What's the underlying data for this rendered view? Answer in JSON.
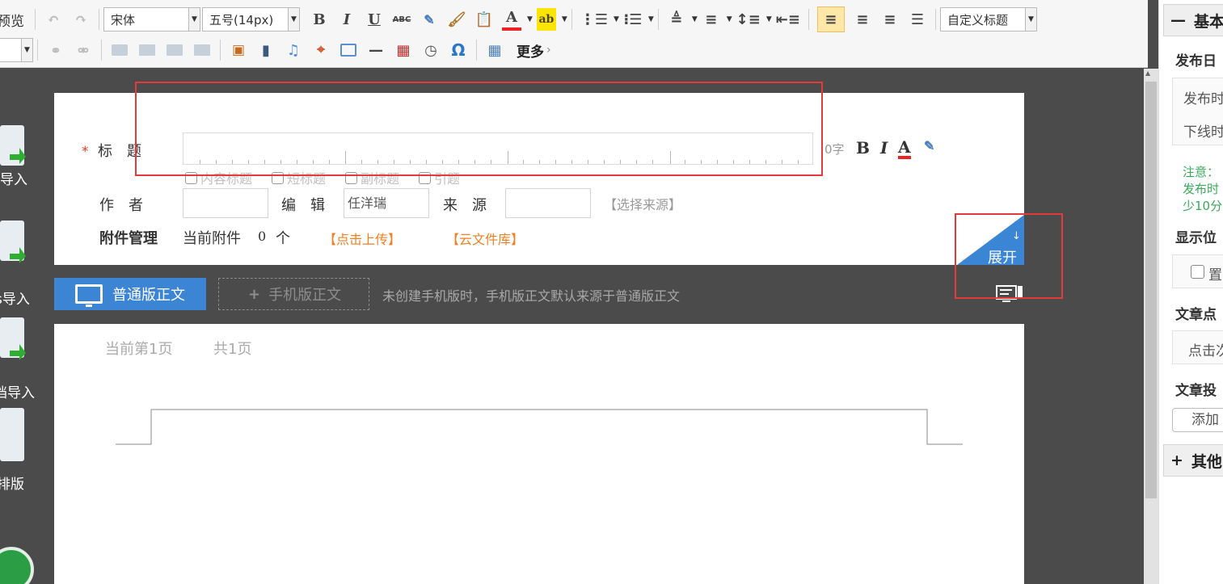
{
  "toolbar": {
    "preview_label": "预览",
    "font_family": "宋体",
    "font_size": "五号(14px)",
    "heading_style": "自定义标题",
    "more_label": "更多",
    "icons": {
      "undo": "undo-icon",
      "redo": "redo-icon",
      "bold": "B",
      "italic": "I",
      "underline": "U",
      "strikethrough": "ABC",
      "font_color": "A",
      "highlight": "ab"
    }
  },
  "left_panel": {
    "items": [
      {
        "label": "导入"
      },
      {
        "label": "s导入"
      },
      {
        "label": "档导入"
      },
      {
        "label": "排版"
      }
    ]
  },
  "header_card": {
    "title_label": "标　题",
    "title_value": "",
    "char_count": "0字",
    "options": [
      "内容标题",
      "短标题",
      "副标题",
      "引题"
    ],
    "author_label": "作　者",
    "author_value": "",
    "editor_label": "编　辑",
    "editor_value": "任洋瑞",
    "source_label": "来　源",
    "source_value": "",
    "choose_source": "【选择来源】",
    "attach_label": "附件管理",
    "attach_prefix": "当前附件",
    "attach_count": "0",
    "attach_suffix": "个",
    "upload_link": "【点击上传】",
    "cloud_link": "【云文件库】",
    "expand_label": "展开"
  },
  "mode_bar": {
    "normal_label": "普通版正文",
    "mobile_label": "手机版正文",
    "hint": "未创建手机版时，手机版正文默认来源于普通版正文"
  },
  "page": {
    "current_page": "当前第1页",
    "total_pages": "共1页"
  },
  "right_panel": {
    "basic_section": "基本",
    "publish_date_label": "发布日",
    "publish_time": "发布时",
    "offline_time": "下线时",
    "note_line1": "注意：",
    "note_line2": "发布时",
    "note_line3": "少10分",
    "display_pos_label": "显示位",
    "pin_label": "置",
    "clicks_label": "文章点",
    "clicks_value": "点击次",
    "contribute_label": "文章投",
    "add_button": "添加",
    "other_section": "其他"
  },
  "colors": {
    "accent_blue": "#3c84d4",
    "orange_link": "#f07f22",
    "annotation_red": "#e33a3a",
    "required_star": "#e23d28"
  }
}
